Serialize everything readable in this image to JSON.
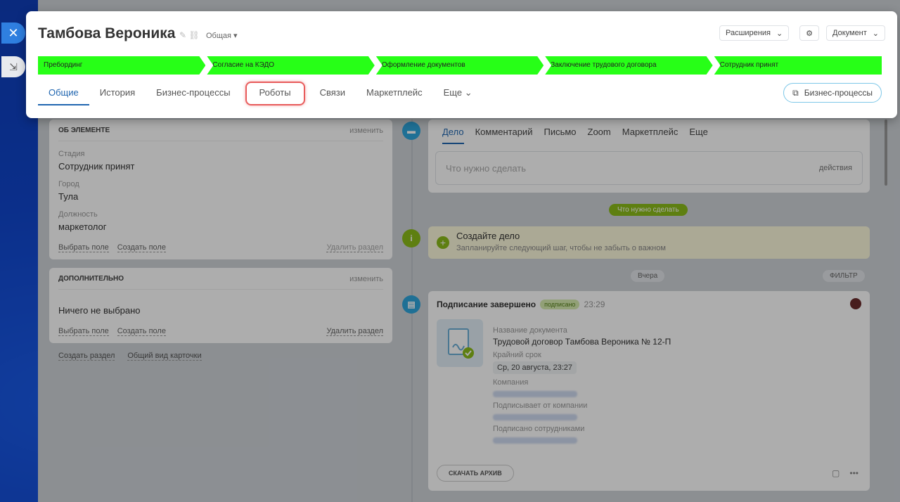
{
  "header": {
    "title": "Тамбова Вероника",
    "category": "Общая",
    "extensions_btn": "Расширения",
    "document_btn": "Документ"
  },
  "stages": [
    "Пребординг",
    "Согласие на КЭДО",
    "Оформление документов",
    "Заключение трудового договора",
    "Сотрудник принят"
  ],
  "tabs": [
    "Общие",
    "История",
    "Бизнес-процессы",
    "Роботы",
    "Связи",
    "Маркетплейс",
    "Еще"
  ],
  "bp_button": "Бизнес-процессы",
  "about": {
    "title": "ОБ ЭЛЕМЕНТЕ",
    "change": "изменить",
    "fields": [
      {
        "label": "Стадия",
        "value": "Сотрудник принят"
      },
      {
        "label": "Город",
        "value": "Тула"
      },
      {
        "label": "Должность",
        "value": "маркетолог"
      }
    ],
    "choose_field": "Выбрать поле",
    "create_field": "Создать поле",
    "delete_section": "Удалить раздел"
  },
  "extra": {
    "title": "ДОПОЛНИТЕЛЬНО",
    "change": "изменить",
    "value": "Ничего не выбрано",
    "choose_field": "Выбрать поле",
    "create_field": "Создать поле",
    "delete_section": "Удалить раздел"
  },
  "bottom": {
    "create_section": "Создать раздел",
    "card_view": "Общий вид карточки"
  },
  "activity": {
    "tabs": [
      "Дело",
      "Комментарий",
      "Письмо",
      "Zoom",
      "Маркетплейс",
      "Еще"
    ],
    "placeholder": "Что нужно сделать",
    "actions": "действия"
  },
  "todo_pill": "Что нужно сделать",
  "create_task": {
    "title": "Создайте дело",
    "subtitle": "Запланируйте следующий шаг, чтобы не забыть о важном"
  },
  "yesterday": "Вчера",
  "filter": "ФИЛЬТР",
  "signing": {
    "title": "Подписание завершено",
    "badge": "подписано",
    "time": "23:29",
    "doc_label": "Название документа",
    "doc_value": "Трудовой договор Тамбова Вероника № 12-П",
    "deadline_label": "Крайний срок",
    "deadline_value": "Ср, 20 августа, 23:27",
    "company_label": "Компания",
    "signer_label": "Подписывает от компании",
    "signed_label": "Подписано сотрудниками",
    "download": "СКАЧАТЬ АРХИВ"
  }
}
